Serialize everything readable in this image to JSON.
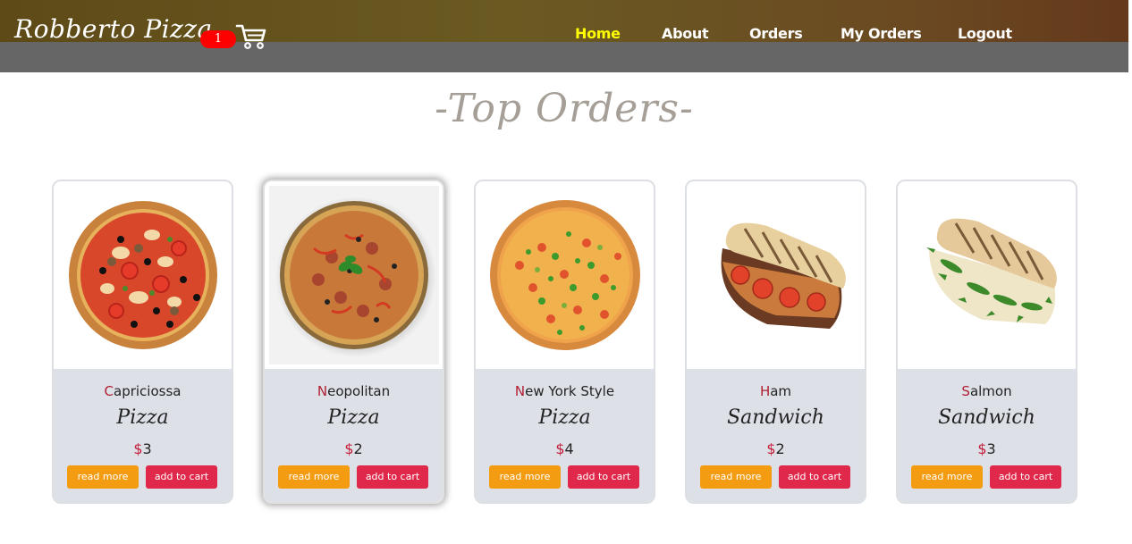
{
  "header": {
    "brand": "Robberto Pizza",
    "cart_count": "1",
    "nav": [
      {
        "label": "Home",
        "active": true
      },
      {
        "label": "About",
        "active": false
      },
      {
        "label": "Orders",
        "active": false
      },
      {
        "label": "My Orders",
        "active": false
      },
      {
        "label": "Logout",
        "active": false
      }
    ]
  },
  "section": {
    "title": "-Top Orders-"
  },
  "cards": [
    {
      "name_first": "C",
      "name_rest": "apriciossa",
      "type": "Pizza",
      "currency": "$",
      "price": "3",
      "read_more": "read more",
      "add_to_cart": "add to cart",
      "image": "pizza-capriciossa"
    },
    {
      "name_first": "N",
      "name_rest": "eopolitan",
      "type": "Pizza",
      "currency": "$",
      "price": "2",
      "read_more": "read more",
      "add_to_cart": "add to cart",
      "image": "pizza-neopolitan"
    },
    {
      "name_first": "N",
      "name_rest": "ew York Style",
      "type": "Pizza",
      "currency": "$",
      "price": "4",
      "read_more": "read more",
      "add_to_cart": "add to cart",
      "image": "pizza-new-york"
    },
    {
      "name_first": "H",
      "name_rest": "am",
      "type": "Sandwich",
      "currency": "$",
      "price": "2",
      "read_more": "read more",
      "add_to_cart": "add to cart",
      "image": "sandwich-ham"
    },
    {
      "name_first": "S",
      "name_rest": "almon",
      "type": "Sandwich",
      "currency": "$",
      "price": "3",
      "read_more": "read more",
      "add_to_cart": "add to cart",
      "image": "sandwich-salmon"
    }
  ],
  "colors": {
    "accent_red": "#e0284a",
    "accent_orange": "#f39c12",
    "nav_active": "#ffff00",
    "badge": "#ff0000"
  }
}
